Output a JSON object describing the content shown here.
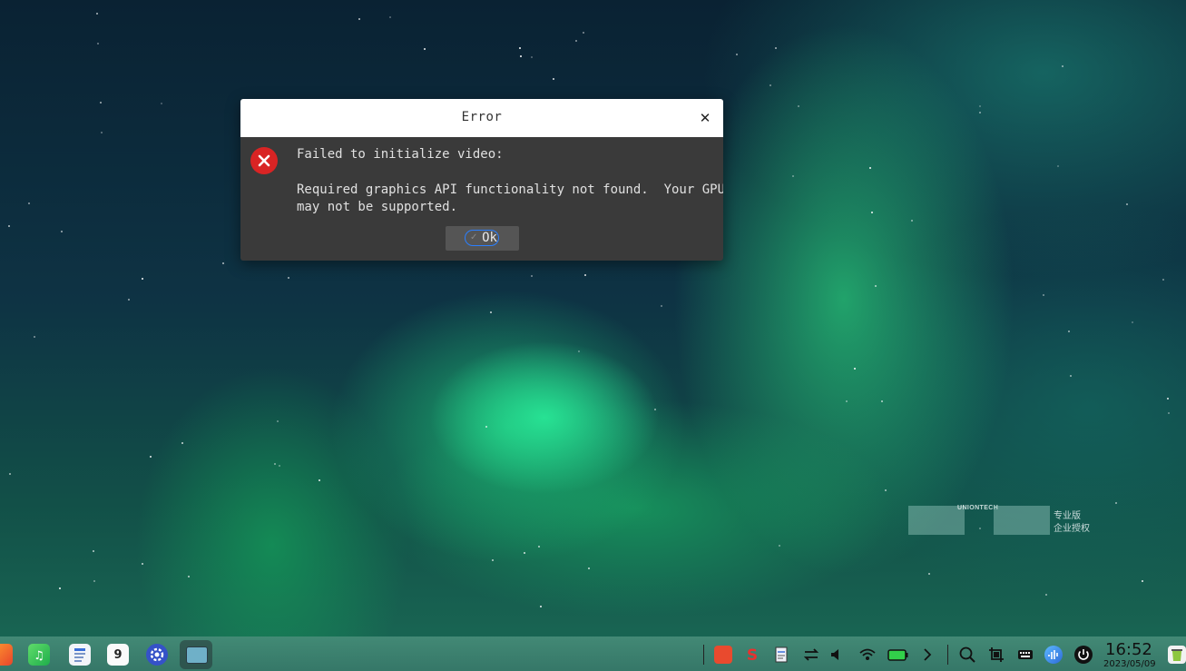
{
  "dialog": {
    "title": "Error",
    "close_label": "✕",
    "message_line1": "Failed to initialize video:",
    "message_line2": "Required graphics API functionality not found.  Your GPU\nmay not be supported.",
    "ok_label": "Ok",
    "icon": "error-icon"
  },
  "watermark": {
    "brand": "UNIONTECH",
    "line1": "专业版",
    "line2": "企业授权"
  },
  "taskbar": {
    "apps": [
      {
        "name": "photos-app-icon"
      },
      {
        "name": "music-app-icon"
      },
      {
        "name": "document-viewer-icon"
      },
      {
        "name": "calendar-app-icon",
        "text": "9"
      },
      {
        "name": "settings-app-icon"
      },
      {
        "name": "terminal-app-icon"
      }
    ],
    "tray": [
      "app-store-icon",
      "input-method-icon",
      "notes-icon",
      "network-transfer-icon",
      "volume-icon",
      "wifi-icon",
      "battery-icon",
      "expand-tray-icon",
      "search-icon",
      "screenshot-icon",
      "keyboard-icon",
      "assistant-icon",
      "power-icon",
      "trash-icon"
    ],
    "clock_time": "16:52",
    "clock_date": "2023/05/09"
  },
  "colors": {
    "dialog_bg": "#3a3a3a",
    "titlebar_bg": "#ffffff",
    "error_red": "#d92424",
    "focus_blue": "#2a7fff"
  }
}
